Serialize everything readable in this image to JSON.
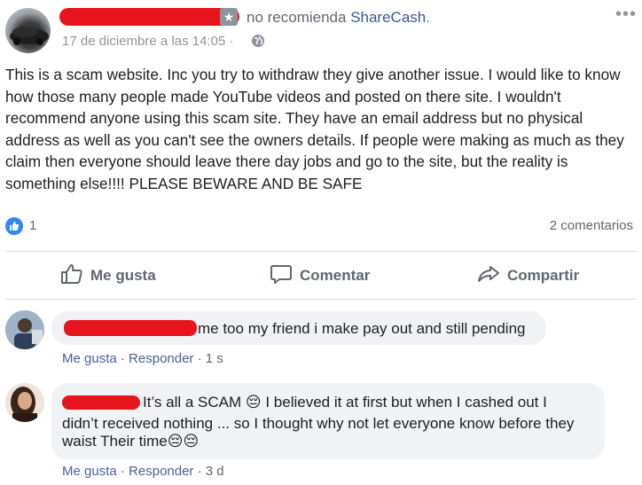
{
  "post": {
    "recommendation_prefix": "no recomienda ",
    "page_name": "ShareCash",
    "page_suffix": ".",
    "timestamp": "17 de diciembre a las 14:05",
    "time_separator": " · ",
    "body": "This is a scam website. Inc you try to withdraw they give another issue. I would like to know how those many people made YouTube videos and posted on there site. I wouldn't recommend anyone using this scam site. They have an email address but no physical address as well as you can't see the owners details. If people were making as much as they claim then everyone should leave there day jobs and go to the site, but the reality is something else!!!! PLEASE BEWARE AND BE SAFE",
    "reaction_count": "1",
    "comment_count": "2 comentarios",
    "colors": {
      "link": "#385898",
      "redaction": "#e8141d",
      "like_blue": "#2d88ff"
    }
  },
  "actions": {
    "like": "Me gusta",
    "comment": "Comentar",
    "share": "Compartir"
  },
  "comments": [
    {
      "text": "me too my friend i make pay out and still pending",
      "like": "Me gusta",
      "reply": "Responder",
      "time": "1 s",
      "sep": " · "
    },
    {
      "text_line1": "It’s all a SCAM 😔 I believed it at first but when I cashed out I",
      "text_line2": "didn’t received nothing ... so I thought why not let everyone know before they",
      "text_line3": "waist Their time😔😔",
      "like": "Me gusta",
      "reply": "Responder",
      "time": "3 d",
      "sep": " · "
    }
  ]
}
